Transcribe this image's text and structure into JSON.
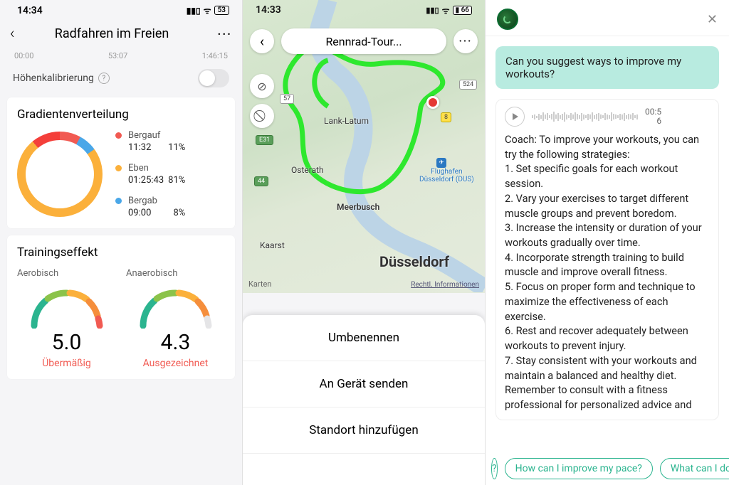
{
  "panel1": {
    "status_time": "14:34",
    "battery": "53",
    "title": "Radfahren im Freien",
    "time_ticks": [
      "00:00",
      "53:07",
      "1:46:15"
    ],
    "calibration_label": "Höhenkalibrierung",
    "gradient": {
      "title": "Gradientenverteilung",
      "items": [
        {
          "label": "Bergauf",
          "time": "11:32",
          "pct": "11%",
          "color": "red"
        },
        {
          "label": "Eben",
          "time": "01:25:43",
          "pct": "81%",
          "color": "yellow"
        },
        {
          "label": "Bergab",
          "time": "09:00",
          "pct": "8%",
          "color": "blue"
        }
      ]
    },
    "effect": {
      "title": "Trainingseffekt",
      "aerobic_label": "Aerobisch",
      "aerobic_value": "5.0",
      "aerobic_status": "Übermäßig",
      "anaerobic_label": "Anaerobisch",
      "anaerobic_value": "4.3",
      "anaerobic_status": "Ausgezeichnet"
    }
  },
  "panel2": {
    "status_time": "14:33",
    "battery": "66",
    "title": "Rennrad-Tour...",
    "map": {
      "places": {
        "lanklatum": "Lank-Latum",
        "osterath": "Osterath",
        "meerbusch": "Meerbusch",
        "kaarst": "Kaarst",
        "dusseldorf": "Düsseldorf",
        "airport": "Flughafen\nDüsseldorf (DUS)"
      },
      "roads": {
        "r57": "57",
        "e31": "E31",
        "r524": "524",
        "r8": "8",
        "r44": "44"
      },
      "provider": "Karten",
      "legal": "Rechtl. Informationen"
    },
    "sheet": {
      "rename": "Umbenennen",
      "send": "An Gerät senden",
      "addloc": "Standort hinzufügen"
    }
  },
  "panel3": {
    "user_msg": "Can you suggest ways to improve my workouts?",
    "voice_time": "00:56",
    "coach_text": "Coach: To improve your workouts, you can try the following strategies:\n1. Set specific goals for each workout session.\n2. Vary your exercises to target different muscle groups and prevent boredom.\n3. Increase the intensity or duration of your workouts gradually over time.\n4. Incorporate strength training to build muscle and improve overall fitness.\n5. Focus on proper form and technique to maximize the effectiveness of each exercise.\n6. Rest and recover adequately between workouts to prevent injury.\n7. Stay consistent with your workouts and maintain a balanced and healthy diet.\nRemember to consult with a fitness professional for personalized advice and",
    "chips": {
      "q1": "How can I improve my pace?",
      "q2": "What can I do"
    }
  }
}
